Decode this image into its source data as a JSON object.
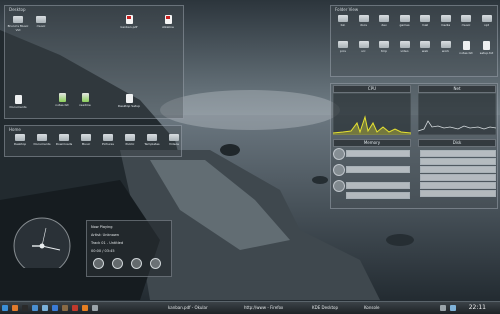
{
  "desktop_icons": [
    {
      "label": "Bruno's Music Vid",
      "icon": "folder-icon",
      "kind": "folder"
    },
    {
      "label": "music",
      "icon": "folder-icon",
      "kind": "folder"
    },
    {
      "label": "kanban.pdf",
      "icon": "pdf-icon",
      "kind": "pdf"
    },
    {
      "label": "Alkaline",
      "icon": "pdf-icon",
      "kind": "pdf"
    },
    {
      "label": "Documents",
      "icon": "document-icon",
      "kind": "doc"
    },
    {
      "label": "notes.txt",
      "icon": "document-icon",
      "kind": "green"
    },
    {
      "label": "readme",
      "icon": "document-icon",
      "kind": "green"
    },
    {
      "label": "Desktop Setup",
      "icon": "document-icon",
      "kind": "doc"
    }
  ],
  "top_left_panel": {
    "title": "Desktop"
  },
  "folder_panel": {
    "title": "Home",
    "items": [
      "Desktop",
      "Documents",
      "Downloads",
      "Music",
      "Pictures",
      "Public",
      "Templates",
      "Videos"
    ]
  },
  "right_folder_panel": {
    "title": "Folder View",
    "items": [
      "bin",
      "docs",
      "dev",
      "games",
      "mail",
      "media",
      "music",
      "opt",
      "pics",
      "src",
      "tmp",
      "video",
      "web",
      "work",
      "notes.txt",
      "setup.txt"
    ]
  },
  "monitors": {
    "cpu_label": "CPU",
    "net_label": "Net",
    "ram_label": "Memory",
    "disk_label": "Disk",
    "accent": "#e6e232"
  },
  "clock_widget": {
    "label": "Clock"
  },
  "media_widget": {
    "lines": [
      "Now Playing",
      "Artist: Unknown",
      "Track 01 - Untitled",
      "00:00 / 03:45"
    ],
    "controls": [
      "previous-icon",
      "play-icon",
      "stop-icon",
      "next-icon"
    ]
  },
  "taskbar": {
    "apps": [
      "Firefox",
      "Konsole",
      "Dolphin",
      "Kate",
      "Amarok",
      "Gimp",
      "Okular",
      "VLC",
      "Settings"
    ],
    "windows": [
      "kanban.pdf - Okular",
      "http://www - Firefox",
      "KDE Desktop",
      "Konsole"
    ],
    "clock": "22:11"
  }
}
